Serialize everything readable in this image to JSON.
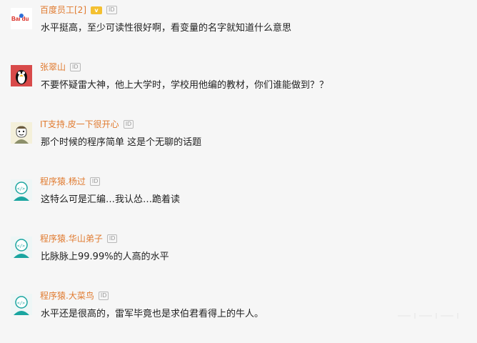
{
  "comments": [
    {
      "author": "百度员工[2]",
      "avatar": "baidu-logo-avatar",
      "avatar_logo_text": "Bai du",
      "vip": "v",
      "id_badge": "ID",
      "text": "水平挺高，至少可读性很好啊，看变量的名字就知道什么意思"
    },
    {
      "author": "张翠山",
      "avatar": "penguin-avatar",
      "id_badge": "ID",
      "text": "不要怀疑雷大神，他上大学时，学校用他编的教材，你们谁能做到？？"
    },
    {
      "author": "IT支持.皮一下很开心",
      "avatar": "cartoon-face-avatar",
      "id_badge": "ID",
      "text": "那个时候的程序简单 这是个无聊的话题"
    },
    {
      "author": "程序猿.杨过",
      "avatar": "coder-avatar",
      "id_badge": "ID",
      "text": "这特么可是汇编…我认怂…跪着读"
    },
    {
      "author": "程序猿.华山弟子",
      "avatar": "coder-avatar",
      "id_badge": "ID",
      "text": "比脉脉上99.99%的人高的水平"
    },
    {
      "author": "程序猿.大菜鸟",
      "avatar": "coder-avatar",
      "id_badge": "ID",
      "text": "水平还是很高的，雷军毕竟也是求伯君看得上的牛人。"
    }
  ],
  "colors": {
    "author": "#e07a2f",
    "text": "#222222",
    "background": "#f6f6f6",
    "coder_avatar": "#1aa5a0"
  }
}
